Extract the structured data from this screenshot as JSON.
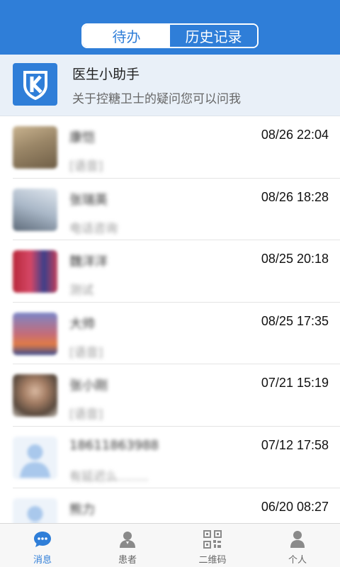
{
  "header": {
    "tabs": [
      {
        "label": "待办",
        "active": true
      },
      {
        "label": "历史记录",
        "active": false
      }
    ]
  },
  "assistant": {
    "name": "医生小助手",
    "description": "关于控糖卫士的疑问您可以问我",
    "logo_icon": "shield-k-logo"
  },
  "conversations": [
    {
      "name": "康恺",
      "preview": "[语音]",
      "time": "08/26 22:04"
    },
    {
      "name": "张瑞英",
      "preview": "电话咨询",
      "time": "08/26 18:28"
    },
    {
      "name": "魏洋洋",
      "preview": "测试",
      "time": "08/25 20:18"
    },
    {
      "name": "大帅",
      "preview": "[语音]",
      "time": "08/25 17:35"
    },
    {
      "name": "张小刚",
      "preview": "[语音]",
      "time": "07/21 15:19"
    },
    {
      "name": "18611863988",
      "preview": "有延迟么........",
      "time": "07/12 17:58"
    },
    {
      "name": "熊力",
      "preview": "",
      "time": "06/20 08:27"
    }
  ],
  "tabbar": {
    "items": [
      {
        "label": "消息",
        "icon": "message-icon",
        "active": true
      },
      {
        "label": "患者",
        "icon": "patient-icon",
        "active": false
      },
      {
        "label": "二维码",
        "icon": "qrcode-icon",
        "active": false
      },
      {
        "label": "个人",
        "icon": "person-icon",
        "active": false
      }
    ]
  },
  "colors": {
    "accent": "#2f7ed8",
    "assistant_bg": "#e9f0f8"
  }
}
